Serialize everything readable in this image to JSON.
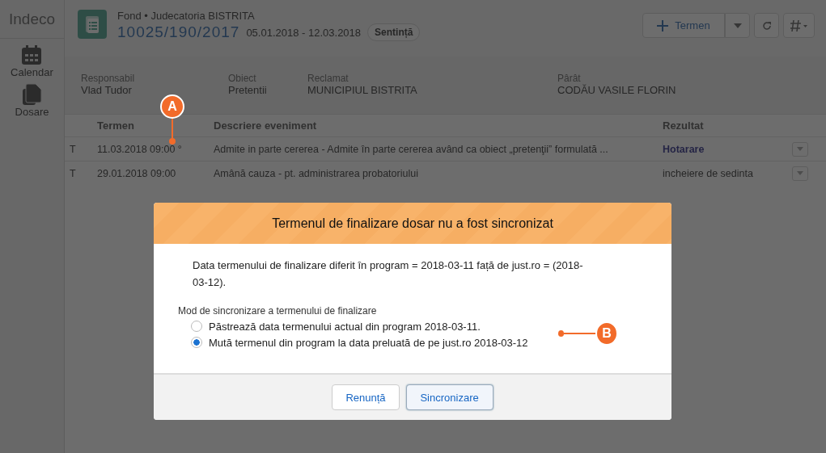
{
  "sidebar": {
    "brand": "Indeco",
    "items": [
      {
        "label": "Calendar",
        "kind": "calendar"
      },
      {
        "label": "Dosare",
        "kind": "documents"
      }
    ]
  },
  "header": {
    "subtitle": "Fond • Judecatoria BISTRITA",
    "case_number": "10025/190/2017",
    "date_range": "05.01.2018 - 12.03.2018",
    "badge": "Sentință",
    "buttons": [
      {
        "kind": "primary",
        "label": "Termen"
      },
      {
        "kind": "dropdown"
      },
      {
        "kind": "refresh"
      },
      {
        "kind": "hash"
      }
    ]
  },
  "details": [
    {
      "label": "Responsabil",
      "value": "Vlad Tudor"
    },
    {
      "label": "Obiect",
      "value": "Pretentii"
    },
    {
      "label": "Reclamat",
      "value": "MUNICIPIUL BISTRITA"
    },
    {
      "label": "Pârât",
      "value": "CODĂU VASILE FLORIN"
    }
  ],
  "table": {
    "columns": [
      "Termen",
      "Descriere eveniment",
      "Rezultat"
    ],
    "rows": [
      {
        "type": "T",
        "termen": "11.03.2018 09:00 °",
        "descriere": "Admite in parte cererea - Admite în parte cererea având ca obiect „pretenţii” formulată ...",
        "rezultat": "Hotarare",
        "rezultat_link": true
      },
      {
        "type": "T",
        "termen": "29.01.2018 09:00",
        "descriere": "Amână cauza - pt. administrarea probatoriului",
        "rezultat": "incheiere de sedinta",
        "rezultat_link": false
      }
    ]
  },
  "modal": {
    "title": "Termenul de finalizare dosar nu a fost sincronizat",
    "message": "Data termenului de finalizare diferit în program = 2018-03-11 față de just.ro = (2018-03-12).",
    "group_label": "Mod de sincronizare a termenului de finalizare",
    "options": [
      {
        "label": "Păstrează data termenului actual din program 2018-03-11.",
        "selected": false
      },
      {
        "label": "Mută termenul din program la data preluată de pe just.ro 2018-03-12",
        "selected": true
      }
    ],
    "buttons": [
      {
        "label": "Renunță",
        "kind": "neutral"
      },
      {
        "label": "Sincronizare",
        "kind": "focused"
      }
    ]
  },
  "callouts": [
    {
      "label": "A"
    },
    {
      "label": "B"
    }
  ]
}
